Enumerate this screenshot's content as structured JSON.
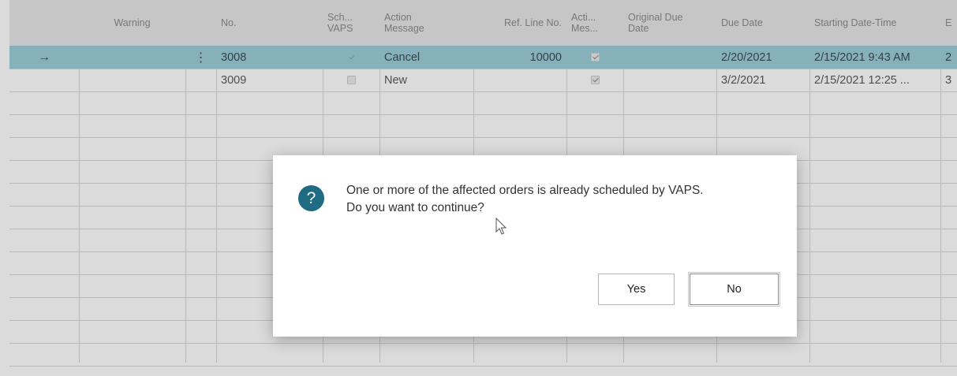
{
  "table": {
    "columns": [
      {
        "key": "arrow",
        "label": ""
      },
      {
        "key": "warning",
        "label": "Warning"
      },
      {
        "key": "menu",
        "label": ""
      },
      {
        "key": "no",
        "label": "No."
      },
      {
        "key": "sch_vaps",
        "label": "Sch...\nVAPS"
      },
      {
        "key": "action_message",
        "label": "Action\nMessage"
      },
      {
        "key": "ref_line_no",
        "label": "Ref. Line No."
      },
      {
        "key": "acti_mes",
        "label": "Acti...\nMes..."
      },
      {
        "key": "original_due_date",
        "label": "Original Due\nDate"
      },
      {
        "key": "due_date",
        "label": "Due Date"
      },
      {
        "key": "starting_date_time",
        "label": "Starting Date-Time"
      },
      {
        "key": "more",
        "label": "E"
      }
    ],
    "rows": [
      {
        "selected": true,
        "arrow": "→",
        "warning": "",
        "menu": "⋮",
        "no": "3008",
        "sch_vaps": true,
        "action_message": "Cancel",
        "ref_line_no": "10000",
        "acti_mes": true,
        "original_due_date": "",
        "due_date": "2/20/2021",
        "starting_date_time": "2/15/2021 9:43 AM",
        "more": "2"
      },
      {
        "selected": false,
        "arrow": "",
        "warning": "",
        "menu": "",
        "no": "3009",
        "sch_vaps": false,
        "action_message": "New",
        "ref_line_no": "",
        "acti_mes": true,
        "original_due_date": "",
        "due_date": "3/2/2021",
        "starting_date_time": "2/15/2021 12:25 ...",
        "more": "3"
      }
    ]
  },
  "dialog": {
    "icon": "question-icon",
    "icon_glyph": "?",
    "message_line1": "One or more of the affected orders is already scheduled by VAPS.",
    "message_line2": "Do you want to continue?",
    "yes_label": "Yes",
    "no_label": "No"
  },
  "colors": {
    "selected_row": "#9ccfd9",
    "header_bg": "#e7e7e7",
    "dialog_icon": "#1e6b82"
  }
}
